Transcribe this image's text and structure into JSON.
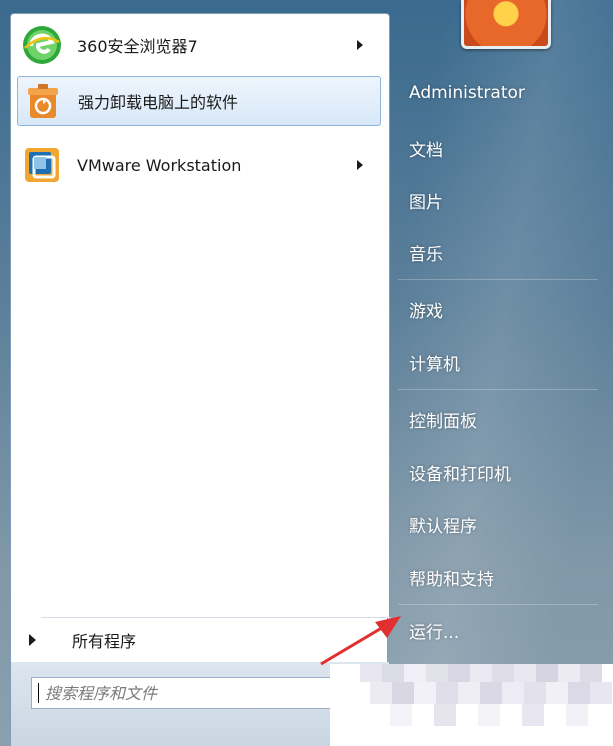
{
  "programs": [
    {
      "label": "360安全浏览器7",
      "icon": "360-browser-icon",
      "has_submenu": true,
      "selected": false
    },
    {
      "label": "强力卸载电脑上的软件",
      "icon": "uninstaller-icon",
      "has_submenu": false,
      "selected": true
    },
    {
      "label": "VMware Workstation",
      "icon": "vmware-icon",
      "has_submenu": true,
      "selected": false
    }
  ],
  "all_programs": {
    "label": "所有程序"
  },
  "search": {
    "placeholder": "搜索程序和文件"
  },
  "right_pane": {
    "user_name": "Administrator",
    "items": [
      "文档",
      "图片",
      "音乐",
      "游戏",
      "计算机",
      "控制面板",
      "设备和打印机",
      "默认程序",
      "帮助和支持",
      "运行..."
    ]
  },
  "colors": {
    "selection_border": "#8eb5e0",
    "annotation_arrow": "#e03030"
  }
}
